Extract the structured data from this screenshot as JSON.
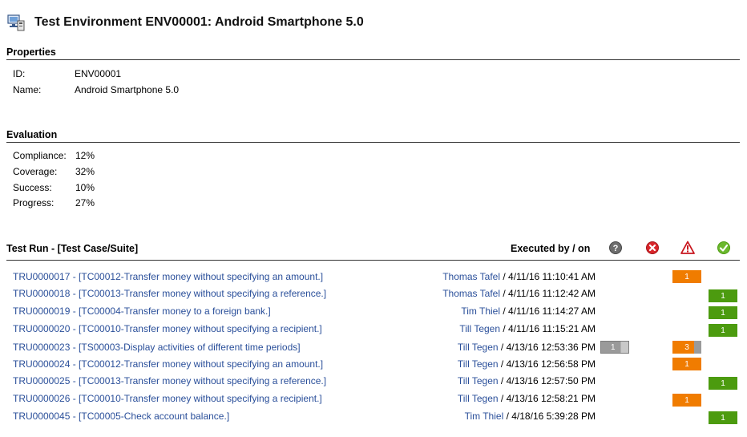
{
  "header": {
    "title": "Test Environment ENV00001: Android Smartphone 5.0",
    "icon": "test-environment-icon"
  },
  "properties": {
    "title": "Properties",
    "rows": [
      {
        "key": "ID:",
        "value": "ENV00001"
      },
      {
        "key": "Name:",
        "value": "Android Smartphone 5.0"
      }
    ]
  },
  "evaluation": {
    "title": "Evaluation",
    "rows": [
      {
        "key": "Compliance:",
        "value": "12%"
      },
      {
        "key": "Coverage:",
        "value": "32%"
      },
      {
        "key": "Success:",
        "value": "10%"
      },
      {
        "key": "Progress:",
        "value": "27%"
      }
    ]
  },
  "runs": {
    "header_run": "Test Run - [Test Case/Suite]",
    "header_executed": "Executed by / on",
    "status_icons": [
      "unknown-icon",
      "failed-icon",
      "warning-icon",
      "passed-icon"
    ],
    "colors": {
      "unknown": "#9a9a9a",
      "warning": "#f07c00",
      "passed": "#4c9b0f",
      "failed": "#d9262b",
      "link": "#2a4f9a"
    },
    "rows": [
      {
        "label": "TRU0000017 - [TC00012-Transfer money without specifying an amount.]",
        "user": "Thomas Tafel",
        "date": " / 4/11/16 11:10:41 AM",
        "unknown": "",
        "warning": "1",
        "passed": ""
      },
      {
        "label": "TRU0000018 - [TC00013-Transfer money without specifying a reference.]",
        "user": "Thomas Tafel",
        "date": " / 4/11/16 11:12:42 AM",
        "unknown": "",
        "warning": "",
        "passed": "1"
      },
      {
        "label": "TRU0000019 - [TC00004-Transfer money to a foreign bank.]",
        "user": "Tim Thiel",
        "date": " / 4/11/16 11:14:27 AM",
        "unknown": "",
        "warning": "",
        "passed": "1"
      },
      {
        "label": "TRU0000020 - [TC00010-Transfer money without specifying a recipient.]",
        "user": "Till Tegen",
        "date": " / 4/11/16 11:15:21 AM",
        "unknown": "",
        "warning": "",
        "passed": "1"
      },
      {
        "label": "TRU0000023 - [TS00003-Display activities of different time periods]",
        "user": "Till Tegen",
        "date": " / 4/13/16 12:53:36 PM",
        "unknown": "1",
        "warning": "3",
        "passed": ""
      },
      {
        "label": "TRU0000024 - [TC00012-Transfer money without specifying an amount.]",
        "user": "Till Tegen",
        "date": " / 4/13/16 12:56:58 PM",
        "unknown": "",
        "warning": "1",
        "passed": ""
      },
      {
        "label": "TRU0000025 - [TC00013-Transfer money without specifying a reference.]",
        "user": "Till Tegen",
        "date": " / 4/13/16 12:57:50 PM",
        "unknown": "",
        "warning": "",
        "passed": "1"
      },
      {
        "label": "TRU0000026 - [TC00010-Transfer money without specifying a recipient.]",
        "user": "Till Tegen",
        "date": " / 4/13/16 12:58:21 PM",
        "unknown": "",
        "warning": "1",
        "passed": ""
      },
      {
        "label": "TRU0000045 - [TC00005-Check account balance.]",
        "user": "Tim Thiel",
        "date": " / 4/18/16 5:39:28 PM",
        "unknown": "",
        "warning": "",
        "passed": "1"
      }
    ]
  }
}
